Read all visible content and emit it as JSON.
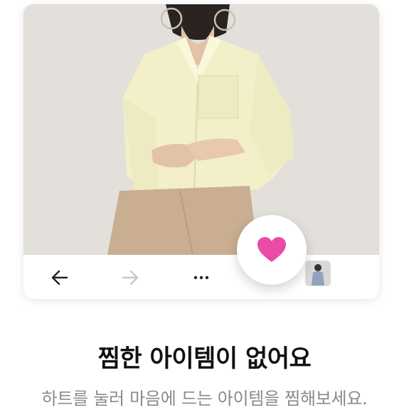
{
  "empty_state": {
    "title": "찜한 아이템이 없어요",
    "subtitle": "하트를 눌러 마음에 드는 아이템을 찜해보세요."
  },
  "toolbar": {
    "back_icon": "arrow-left-icon",
    "forward_icon": "arrow-right-icon",
    "more_icon": "more-horizontal-icon",
    "forward_enabled": false
  },
  "favorite": {
    "icon": "heart-icon",
    "color": "#EB4BA7"
  },
  "colors": {
    "title": "#111111",
    "subtitle": "#8A8A8A",
    "icon_active": "#222222",
    "icon_disabled": "#C8C8C8"
  }
}
